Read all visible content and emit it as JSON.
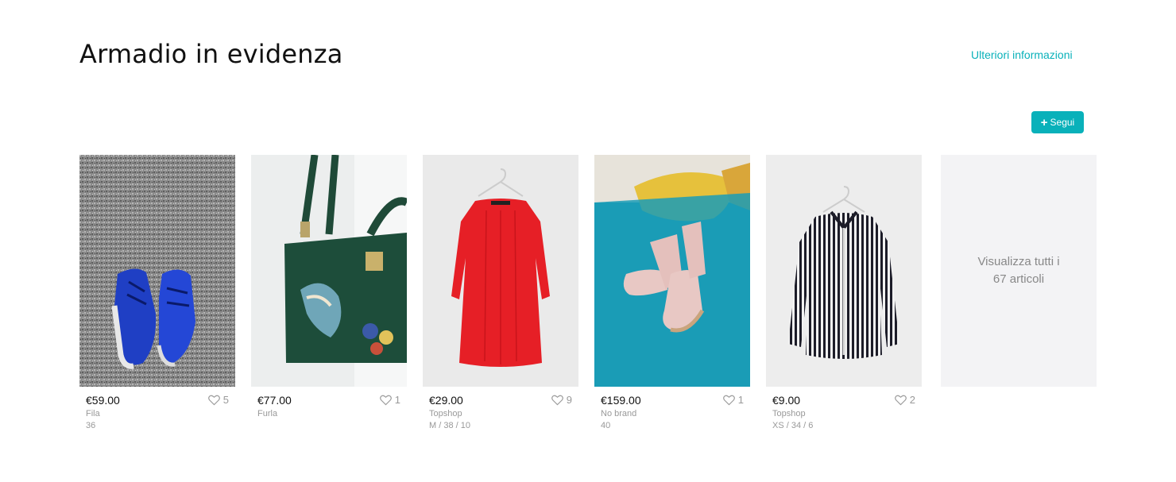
{
  "section": {
    "title": "Armadio in evidenza",
    "more_info_label": "Ulteriori informazioni",
    "follow_label": "Segui",
    "accent_color": "#09b1ba"
  },
  "items": [
    {
      "price": "€59.00",
      "likes": "5",
      "brand": "Fila",
      "size": "36",
      "photo": "blue sneakers on grey carpet"
    },
    {
      "price": "€77.00",
      "likes": "1",
      "brand": "Furla",
      "size": "",
      "photo": "green handbag with bird embroidery"
    },
    {
      "price": "€29.00",
      "likes": "9",
      "brand": "Topshop",
      "size": "M / 38 / 10",
      "photo": "red dress on hanger"
    },
    {
      "price": "€159.00",
      "likes": "1",
      "brand": "No brand",
      "size": "40",
      "photo": "pink boots on blue bedspread"
    },
    {
      "price": "€9.00",
      "likes": "2",
      "brand": "Topshop",
      "size": "XS / 34 / 6",
      "photo": "striped shirt on hanger"
    }
  ],
  "see_all": {
    "line1": "Visualizza tutti i",
    "line2": "67 articoli"
  }
}
